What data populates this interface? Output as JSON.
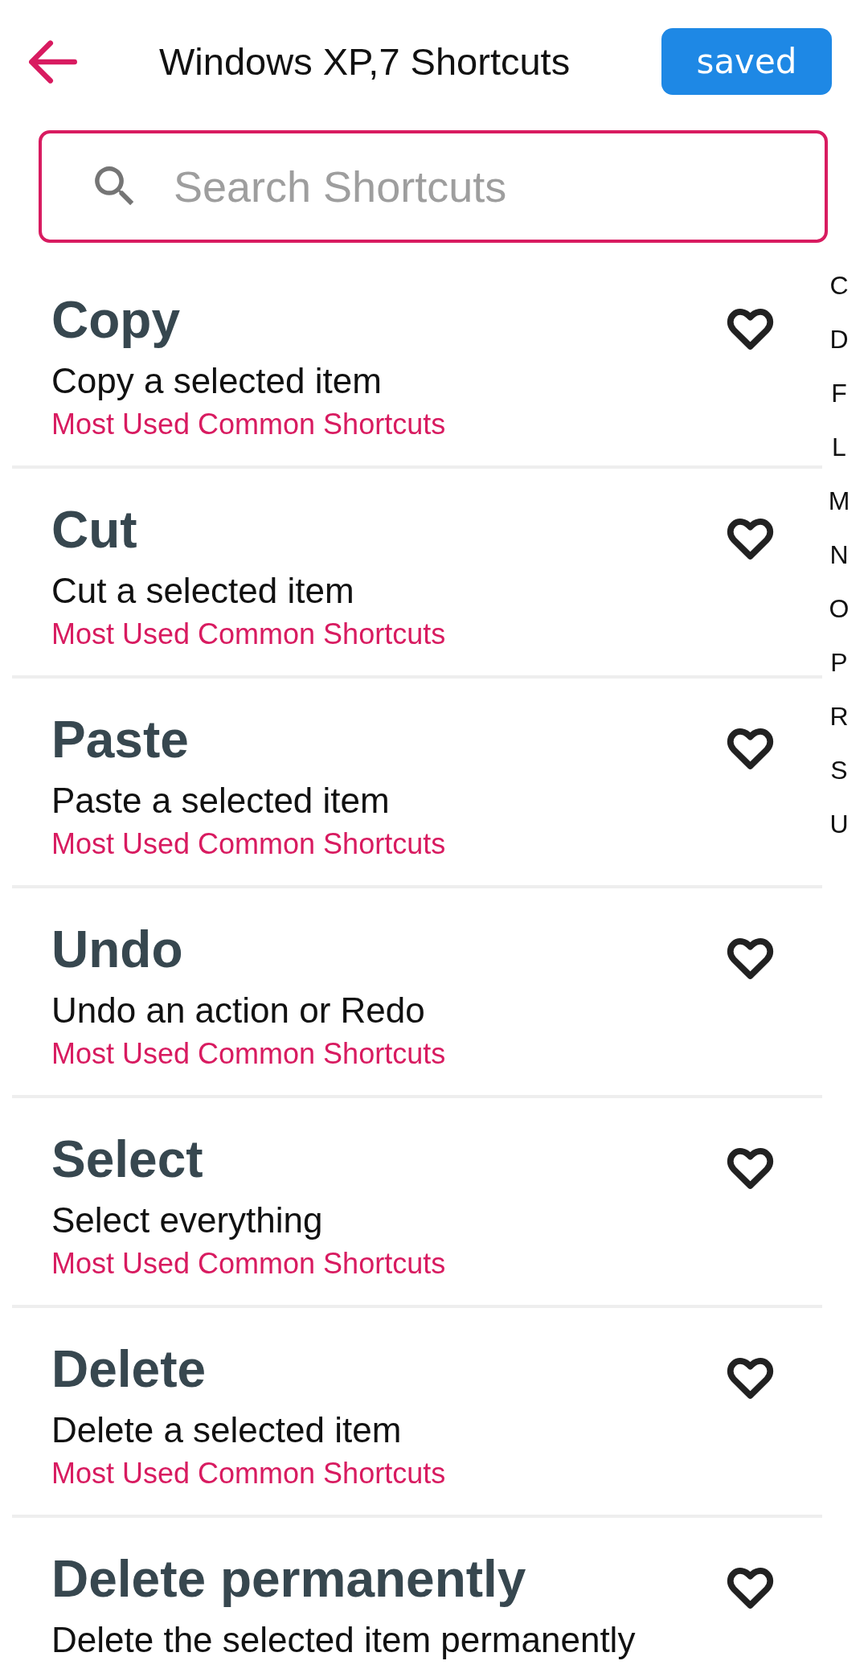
{
  "header": {
    "title": "Windows XP,7 Shortcuts",
    "saved_button": "saved"
  },
  "search": {
    "placeholder": "Search Shortcuts"
  },
  "shortcuts": [
    {
      "title": "Copy",
      "description": "Copy a selected item",
      "category": "Most Used Common Shortcuts",
      "favorite": false
    },
    {
      "title": "Cut",
      "description": "Cut a selected item",
      "category": "Most Used Common Shortcuts",
      "favorite": false
    },
    {
      "title": "Paste",
      "description": "Paste a selected item",
      "category": "Most Used Common Shortcuts",
      "favorite": false
    },
    {
      "title": "Undo",
      "description": "Undo an action or Redo",
      "category": "Most Used Common Shortcuts",
      "favorite": false
    },
    {
      "title": "Select",
      "description": "Select everything",
      "category": "Most Used Common Shortcuts",
      "favorite": false
    },
    {
      "title": "Delete",
      "description": "Delete a selected item",
      "category": "Most Used Common Shortcuts",
      "favorite": false
    },
    {
      "title": "Delete permanently",
      "description": "Delete the selected item permanently",
      "favorite": false
    }
  ],
  "index_letters": [
    "C",
    "D",
    "F",
    "L",
    "M",
    "N",
    "O",
    "P",
    "R",
    "S",
    "U"
  ]
}
